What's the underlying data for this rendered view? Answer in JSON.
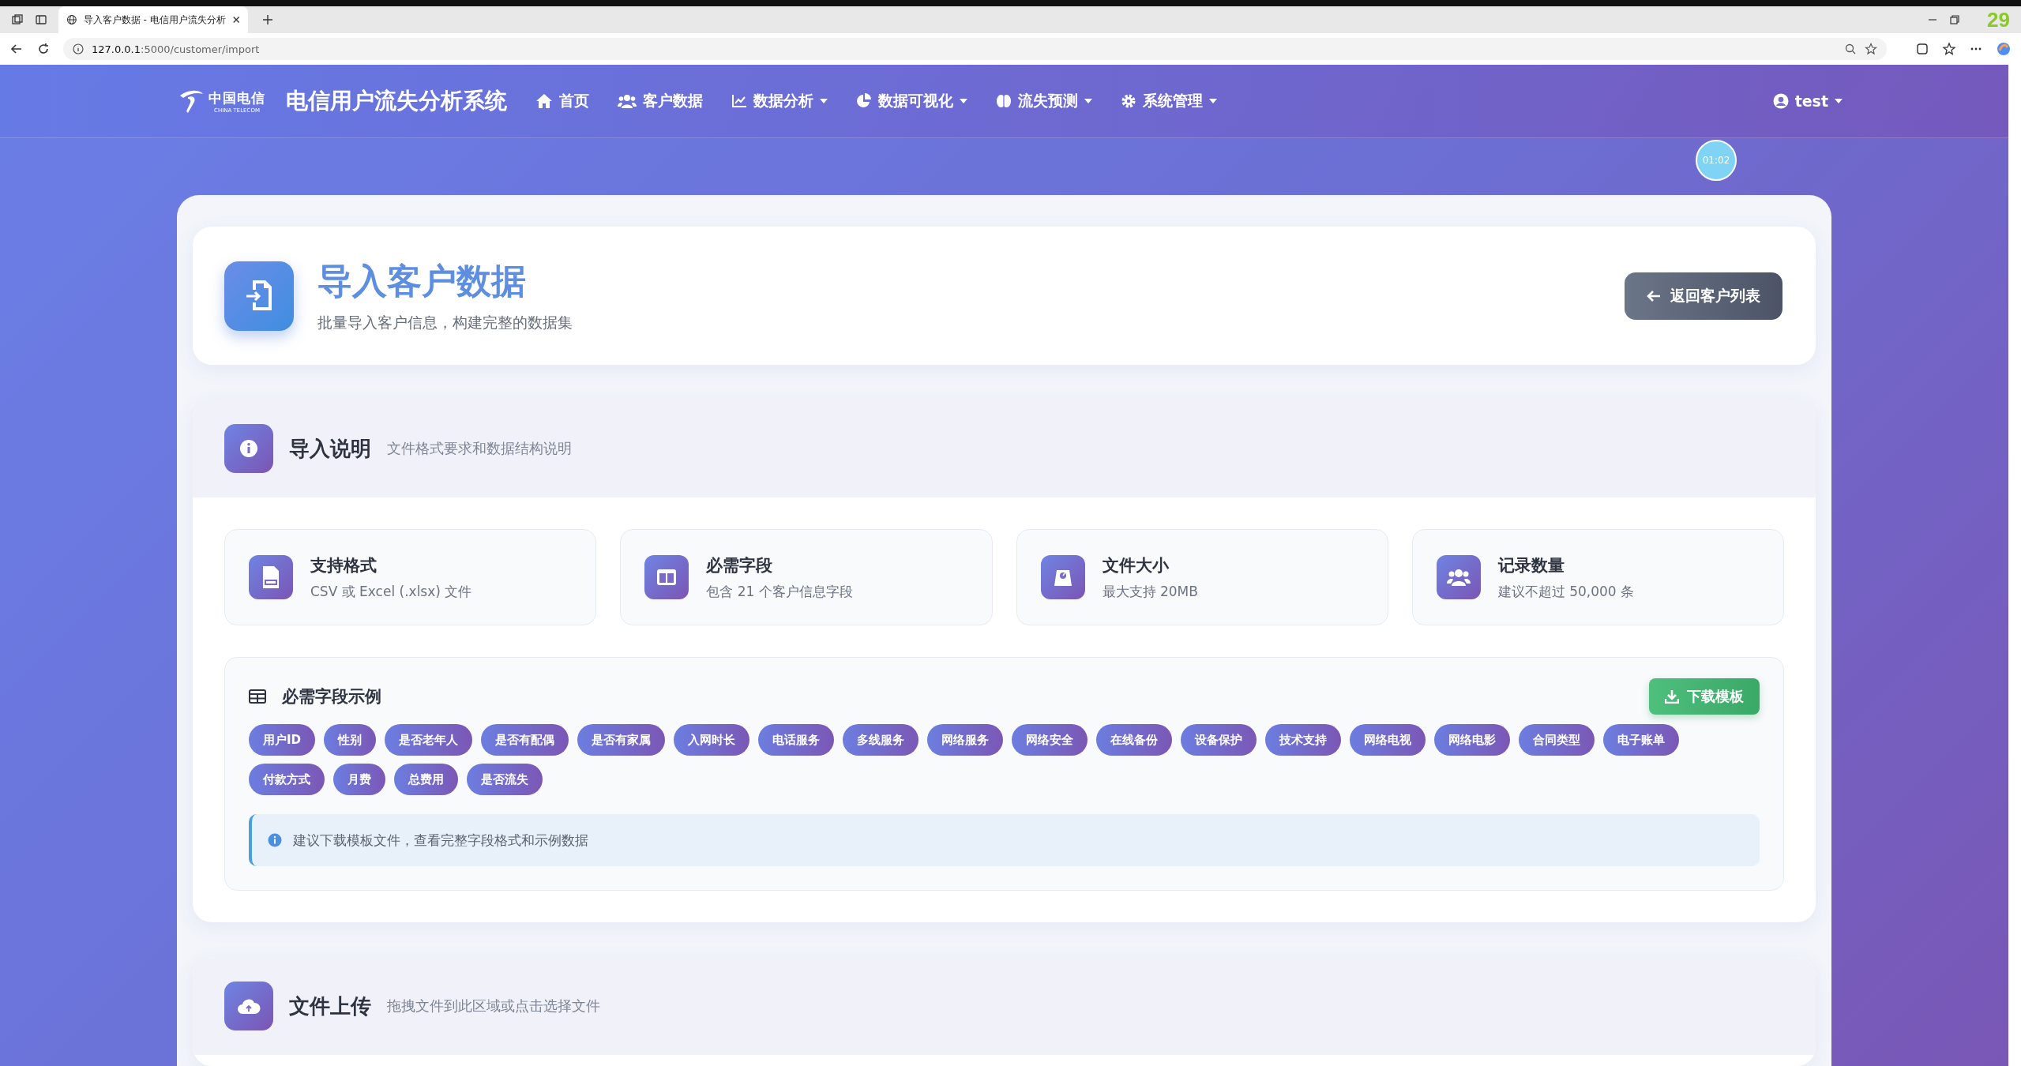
{
  "browser": {
    "tab_title": "导入客户数据 - 电信用户流失分析",
    "url_host": "127.0.0.1",
    "url_path": ":5000/customer/import",
    "corner_badge": "29"
  },
  "navbar": {
    "brand": "电信用户流失分析系统",
    "logo_text": "中国电信",
    "logo_sub": "CHINA TELECOM",
    "items": [
      {
        "label": "首页",
        "kind": "home",
        "dropdown": false
      },
      {
        "label": "客户数据",
        "kind": "users",
        "dropdown": false
      },
      {
        "label": "数据分析",
        "kind": "chart",
        "dropdown": true
      },
      {
        "label": "数据可视化",
        "kind": "pie",
        "dropdown": true
      },
      {
        "label": "流失预测",
        "kind": "brain",
        "dropdown": true
      },
      {
        "label": "系统管理",
        "kind": "gear",
        "dropdown": true
      }
    ],
    "user": "test"
  },
  "timer": "01:02",
  "header": {
    "title": "导入客户数据",
    "subtitle": "批量导入客户信息，构建完整的数据集",
    "back_button": "返回客户列表"
  },
  "instructions": {
    "title": "导入说明",
    "subtitle": "文件格式要求和数据结构说明",
    "cards": [
      {
        "kind": "csv",
        "title": "支持格式",
        "desc": "CSV 或 Excel (.xlsx) 文件"
      },
      {
        "kind": "columns",
        "title": "必需字段",
        "desc": "包含 21 个客户信息字段"
      },
      {
        "kind": "weight",
        "title": "文件大小",
        "desc": "最大支持 20MB"
      },
      {
        "kind": "users",
        "title": "记录数量",
        "desc": "建议不超过 50,000 条"
      }
    ],
    "fields": {
      "title": "必需字段示例",
      "download_button": "下载模板",
      "tags": [
        "用户ID",
        "性别",
        "是否老年人",
        "是否有配偶",
        "是否有家属",
        "入网时长",
        "电话服务",
        "多线服务",
        "网络服务",
        "网络安全",
        "在线备份",
        "设备保护",
        "技术支持",
        "网络电视",
        "网络电影",
        "合同类型",
        "电子账单",
        "付款方式",
        "月费",
        "总费用",
        "是否流失"
      ],
      "note": "建议下载模板文件，查看完整字段格式和示例数据"
    }
  },
  "upload": {
    "title": "文件上传",
    "subtitle": "拖拽文件到此区域或点击选择文件"
  }
}
